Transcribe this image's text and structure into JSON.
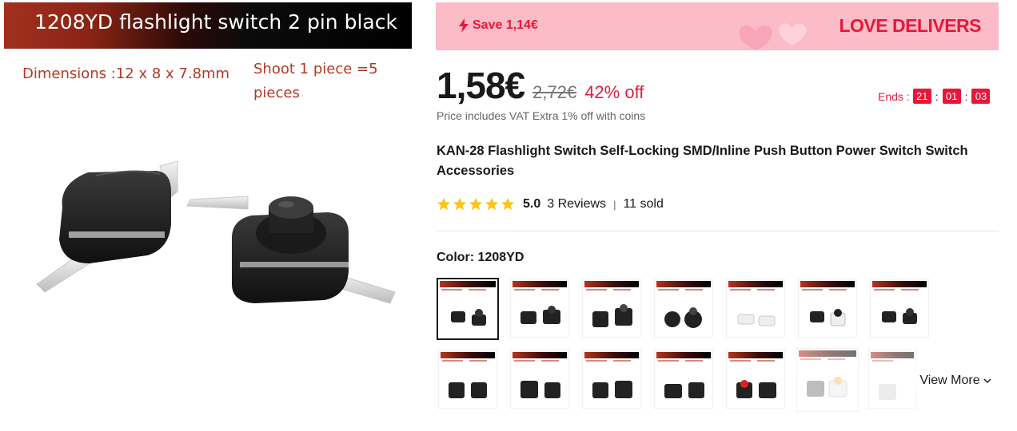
{
  "product_image": {
    "banner_text": "1208YD flashlight switch 2 pin black",
    "dimensions_text": "Dimensions :12 x 8 x 7.8mm",
    "shoot_text": "Shoot 1 piece =5 pieces"
  },
  "promo": {
    "save_text": "Save 1,14€",
    "brand_text": "LOVE DELIVERS",
    "bolt_icon": "bolt-icon"
  },
  "price": {
    "current": "1,58€",
    "original": "2,72€",
    "discount": "42% off",
    "vat_note": "Price includes VAT Extra 1% off with coins"
  },
  "countdown": {
    "label": "Ends :",
    "hours": "21",
    "minutes": "01",
    "seconds": "03",
    "separator": ":"
  },
  "title": "KAN-28 Flashlight Switch Self-Locking SMD/Inline Push Button Power Switch Switch Accessories",
  "rating": {
    "value": "5.0",
    "stars": 5,
    "reviews": "3 Reviews",
    "separator": "|",
    "sold": "11 sold"
  },
  "color": {
    "label": "Color: 1208YD"
  },
  "view_more": "View More",
  "colors": {
    "accent_red": "#e8173a",
    "promo_pink": "#fbbcc8",
    "star_yellow": "#fcc419",
    "text_dark": "#191919"
  }
}
